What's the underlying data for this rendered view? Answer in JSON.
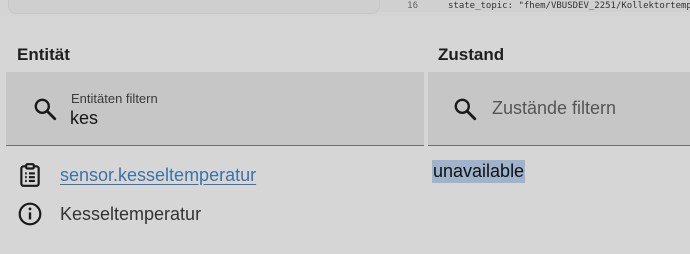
{
  "editor": {
    "line_number": "16",
    "code_line": "state_topic: \"fhem/VBUSDEV_2251/Kollektortemper"
  },
  "headers": {
    "entity": "Entität",
    "state": "Zustand"
  },
  "entity_filter": {
    "label": "Entitäten filtern",
    "value": "kes",
    "icon": "search-icon"
  },
  "state_filter": {
    "placeholder": "Zustände filtern",
    "value": "",
    "icon": "search-icon"
  },
  "result": {
    "entity_id": "sensor.kesseltemperatur",
    "friendly_name": "Kesseltemperatur",
    "state": "unavailable",
    "entity_icon": "clipboard-list-icon",
    "info_icon": "info-icon"
  },
  "colors": {
    "background": "#d6d6d6",
    "filter_background": "#c6c6c6",
    "link": "#3b73a8",
    "selection": "#9fb3cc"
  }
}
